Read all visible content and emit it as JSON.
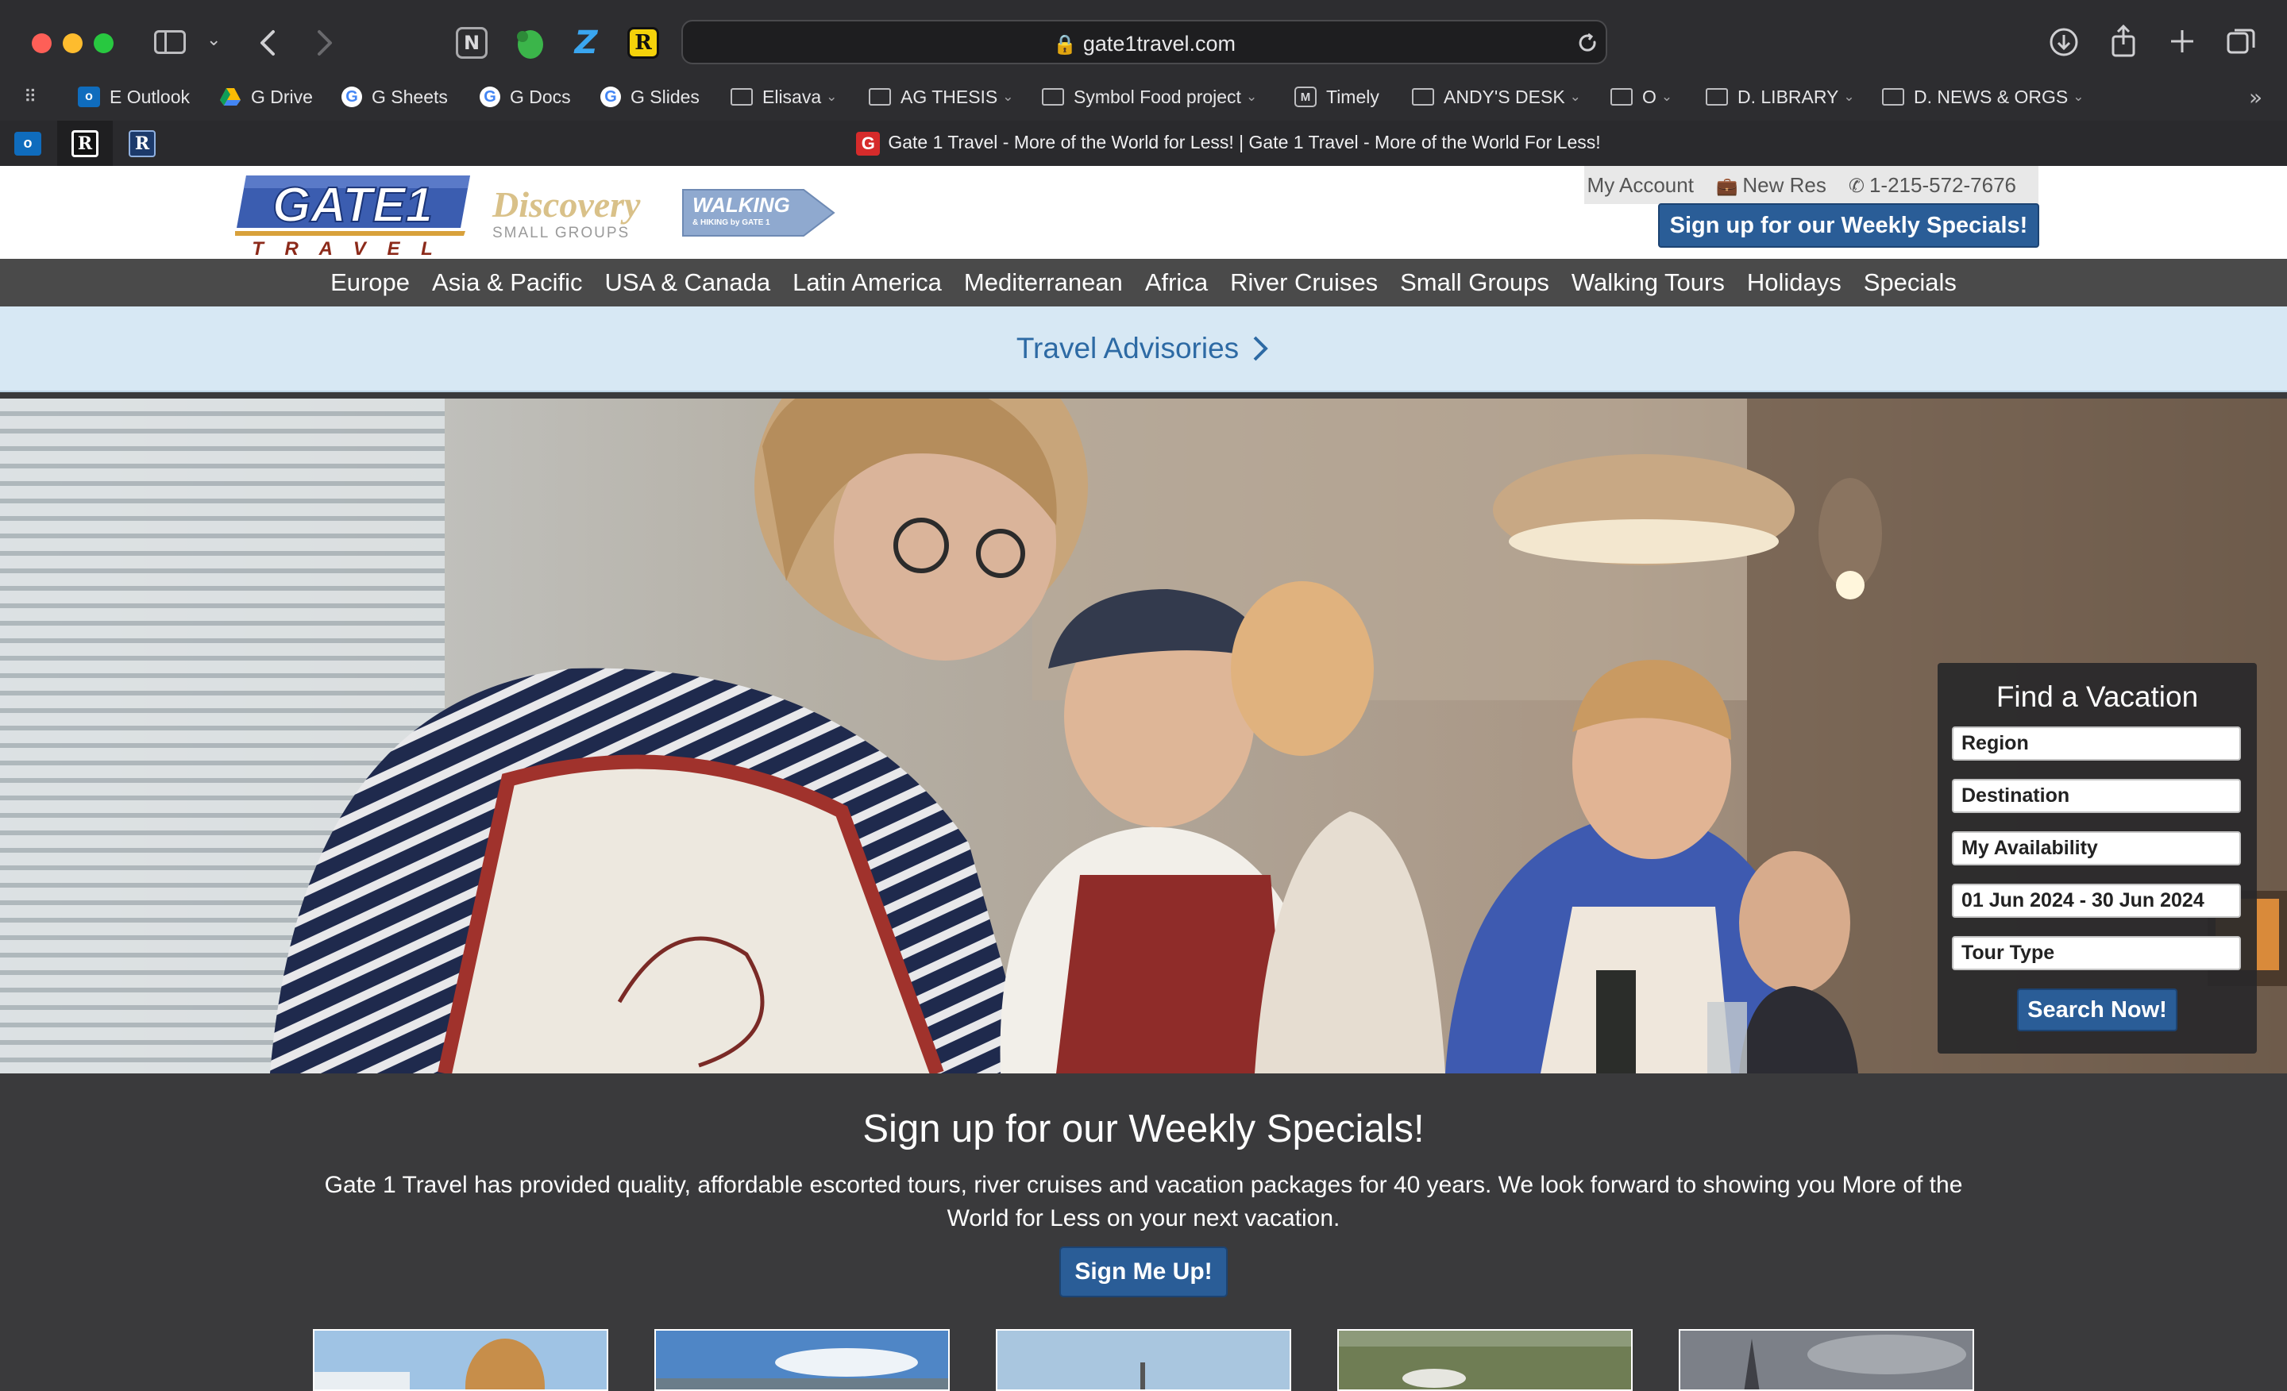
{
  "browser": {
    "url": "gate1travel.com",
    "tab_title": "Gate 1 Travel - More of the World for Less! | Gate 1 Travel - More of the World For Less!",
    "bookmarks": [
      {
        "label": "E Outlook",
        "icon": "outlook-icon"
      },
      {
        "label": "G Drive",
        "icon": "google-drive-icon"
      },
      {
        "label": "G Sheets",
        "icon": "google-icon"
      },
      {
        "label": "G Docs",
        "icon": "google-icon"
      },
      {
        "label": "G Slides",
        "icon": "google-icon"
      },
      {
        "label": "Elisava",
        "icon": "folder-icon"
      },
      {
        "label": "AG THESIS",
        "icon": "folder-icon"
      },
      {
        "label": "Symbol Food project",
        "icon": "folder-icon"
      },
      {
        "label": "Timely",
        "icon": "timely-icon"
      },
      {
        "label": "ANDY'S DESK",
        "icon": "folder-icon"
      },
      {
        "label": "O",
        "icon": "folder-icon"
      },
      {
        "label": "D. LIBRARY",
        "icon": "folder-icon"
      },
      {
        "label": "D. NEWS & ORGS",
        "icon": "folder-icon"
      }
    ],
    "extensions": [
      "N",
      "Z",
      "R"
    ],
    "pinned_tabs": [
      "R",
      "R"
    ]
  },
  "header": {
    "logo_text": "GATE1",
    "logo_sub": "T R A V E L",
    "discovery_text": "Discovery",
    "discovery_sub": "SMALL GROUPS",
    "walking_text": "WALKING",
    "walking_sub": "& HIKING by GATE 1",
    "my_account": "My Account",
    "new_res": "New Res",
    "phone": "1-215-572-7676",
    "signup_label": "Sign up for our Weekly Specials!"
  },
  "nav": [
    "Europe",
    "Asia & Pacific",
    "USA & Canada",
    "Latin America",
    "Mediterranean",
    "Africa",
    "River Cruises",
    "Small Groups",
    "Walking Tours",
    "Holidays",
    "Specials"
  ],
  "advisory": {
    "label": "Travel Advisories"
  },
  "finder": {
    "title": "Find a Vacation",
    "region": "Region",
    "destination": "Destination",
    "availability": "My Availability",
    "dates": "01 Jun 2024 - 30 Jun 2024",
    "tour_type": "Tour Type",
    "search_label": "Search Now!"
  },
  "signup": {
    "heading": "Sign up for our Weekly Specials!",
    "body_line1": "Gate 1 Travel has provided quality, affordable escorted tours, river cruises and vacation packages for 40 years. We look forward to showing you More of the",
    "body_line2": "World for Less on your next vacation.",
    "button": "Sign Me Up!"
  },
  "colors": {
    "brand_blue": "#2a5d97",
    "nav_bg": "#4a4a4a",
    "advisory_bg": "#d7e8f4",
    "advisory_text": "#2d6aa4",
    "section_bg": "#3a3a3c"
  }
}
